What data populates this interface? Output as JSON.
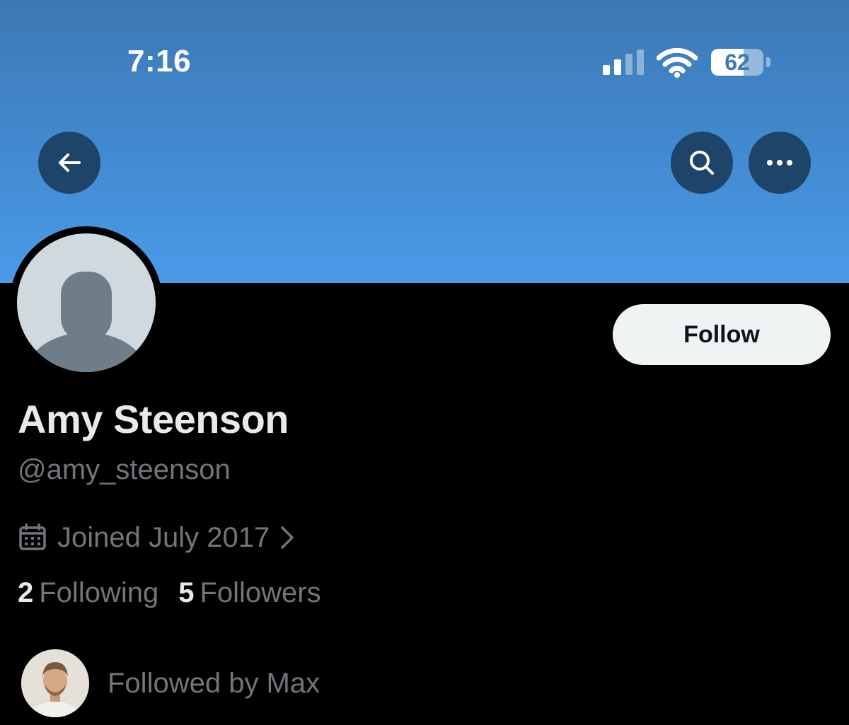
{
  "status_bar": {
    "time": "7:16",
    "battery_level": "62",
    "battery_percent": 62,
    "signal_bars_active": 2,
    "signal_bars_total": 4
  },
  "nav": {
    "back_icon": "arrow-left-icon",
    "search_icon": "search-icon",
    "more_icon": "more-horizontal-icon"
  },
  "colors": {
    "banner_top": "#3d79b4",
    "banner_bottom": "#4a9ae8",
    "background": "#000000",
    "nav_button": "#1f4469",
    "follow_button_bg": "#eff3f4",
    "primary_text": "#e7e9ea",
    "secondary_text": "#71767b"
  },
  "profile": {
    "avatar_icon": "default-avatar-icon",
    "follow_label": "Follow",
    "display_name": "Amy Steenson",
    "handle": "@amy_steenson",
    "joined_icon": "calendar-icon",
    "joined_text": "Joined July 2017",
    "following_count": "2",
    "following_label": "Following",
    "followers_count": "5",
    "followers_label": "Followers",
    "followed_by_text": "Followed by Max"
  }
}
